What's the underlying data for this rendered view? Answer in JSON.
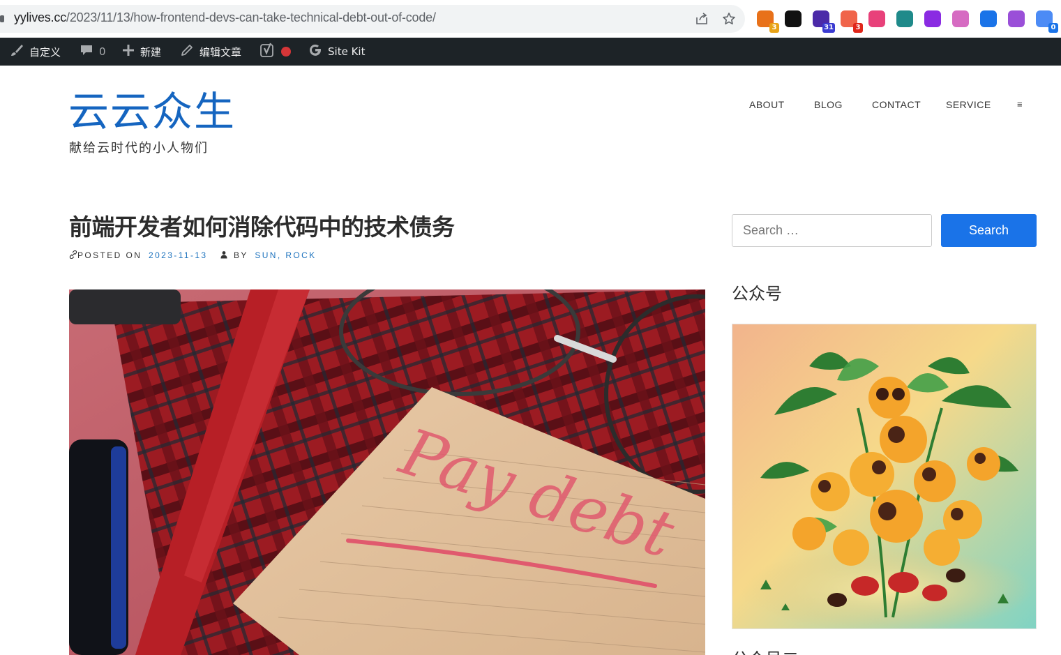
{
  "browser": {
    "url_host": "yylives.cc",
    "url_path": "/2023/11/13/how-frontend-devs-can-take-technical-debt-out-of-code/",
    "extensions": [
      {
        "name": "ext-1",
        "badge": "3",
        "color": "#e8711a",
        "badge_color": "#e8a317"
      },
      {
        "name": "notion",
        "badge": "",
        "color": "#111111",
        "badge_color": ""
      },
      {
        "name": "ext-3",
        "badge": "31",
        "color": "#4b2aa8",
        "badge_color": "#3b3bd1"
      },
      {
        "name": "ext-4",
        "badge": "3",
        "color": "#f0644a",
        "badge_color": "#e0261a"
      },
      {
        "name": "ext-5",
        "badge": "",
        "color": "#e8417a",
        "badge_color": ""
      },
      {
        "name": "ext-6",
        "badge": "",
        "color": "#1f8a8a",
        "badge_color": ""
      },
      {
        "name": "ext-7",
        "badge": "",
        "color": "#8a2be2",
        "badge_color": ""
      },
      {
        "name": "ext-8",
        "badge": "",
        "color": "#d66bc2",
        "badge_color": ""
      },
      {
        "name": "ext-9",
        "badge": "",
        "color": "#1a73e8",
        "badge_color": ""
      },
      {
        "name": "openai",
        "badge": "",
        "color": "#9a4fd8",
        "badge_color": ""
      },
      {
        "name": "ext-11",
        "badge": "0",
        "color": "#4c8bf5",
        "badge_color": "#1a73e8"
      }
    ]
  },
  "adminbar": {
    "customize": "自定义",
    "comments_count": "0",
    "new": "新建",
    "edit": "编辑文章",
    "sitekit": "Site Kit"
  },
  "site": {
    "title": "云云众生",
    "description": "献给云时代的小人物们"
  },
  "nav": {
    "items": [
      "ABOUT",
      "BLOG",
      "CONTACT",
      "SERVICE"
    ],
    "menu_glyph": "≡"
  },
  "post": {
    "title": "前端开发者如何消除代码中的技术债务",
    "posted_on_label": "POSTED ON",
    "date": "2023-11-13",
    "by_label": "BY",
    "author": "SUN, ROCK",
    "image_note_text": "Pay debt"
  },
  "sidebar": {
    "search_placeholder": "Search …",
    "search_button": "Search",
    "widget_title": "公众号",
    "widget_title_2": "公众号二"
  },
  "colors": {
    "brand_blue": "#1565c0",
    "link_blue": "#1e73be",
    "button_blue": "#1a73e8",
    "admin_bar": "#1d2327"
  }
}
